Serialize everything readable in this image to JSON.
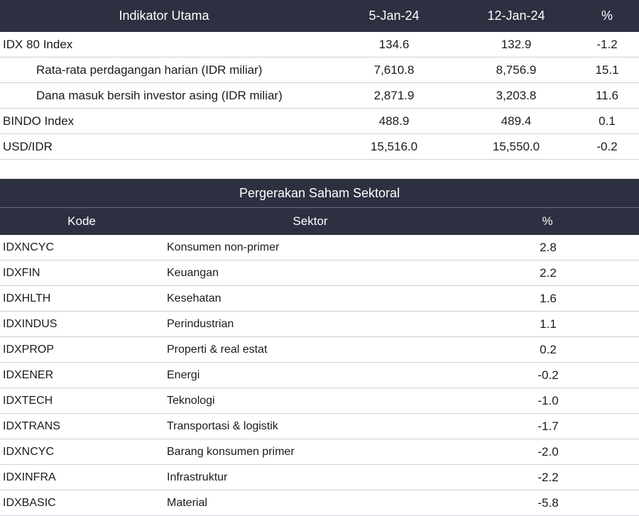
{
  "indicators": {
    "headers": {
      "label": "Indikator Utama",
      "date1": "5-Jan-24",
      "date2": "12-Jan-24",
      "change": "%"
    },
    "rows": [
      {
        "label": "IDX 80 Index",
        "v1": "134.6",
        "v2": "132.9",
        "pct": "-1.2"
      },
      {
        "label": "Rata-rata perdagangan harian (IDR miliar)",
        "v1": "7,610.8",
        "v2": "8,756.9",
        "pct": "15.1"
      },
      {
        "label": "Dana masuk bersih investor asing (IDR miliar)",
        "v1": "2,871.9",
        "v2": "3,203.8",
        "pct": "11.6"
      },
      {
        "label": "BINDO Index",
        "v1": "488.9",
        "v2": "489.4",
        "pct": "0.1"
      },
      {
        "label": "USD/IDR",
        "v1": "15,516.0",
        "v2": "15,550.0",
        "pct": "-0.2"
      }
    ]
  },
  "sectors": {
    "title": "Pergerakan Saham Sektoral",
    "headers": {
      "code": "Kode",
      "sector": "Sektor",
      "change": "%"
    },
    "rows": [
      {
        "code": "IDXNCYC",
        "sector": "Konsumen non-primer",
        "pct": "2.8"
      },
      {
        "code": "IDXFIN",
        "sector": "Keuangan",
        "pct": "2.2"
      },
      {
        "code": "IDXHLTH",
        "sector": "Kesehatan",
        "pct": "1.6"
      },
      {
        "code": "IDXINDUS",
        "sector": "Perindustrian",
        "pct": "1.1"
      },
      {
        "code": "IDXPROP",
        "sector": "Properti & real estat",
        "pct": "0.2"
      },
      {
        "code": "IDXENER",
        "sector": "Energi",
        "pct": "-0.2"
      },
      {
        "code": "IDXTECH",
        "sector": "Teknologi",
        "pct": "-1.0"
      },
      {
        "code": "IDXTRANS",
        "sector": "Transportasi & logistik",
        "pct": "-1.7"
      },
      {
        "code": "IDXNCYC",
        "sector": "Barang konsumen primer",
        "pct": "-2.0"
      },
      {
        "code": "IDXINFRA",
        "sector": "Infrastruktur",
        "pct": "-2.2"
      },
      {
        "code": "IDXBASIC",
        "sector": "Material",
        "pct": "-5.8"
      }
    ]
  }
}
